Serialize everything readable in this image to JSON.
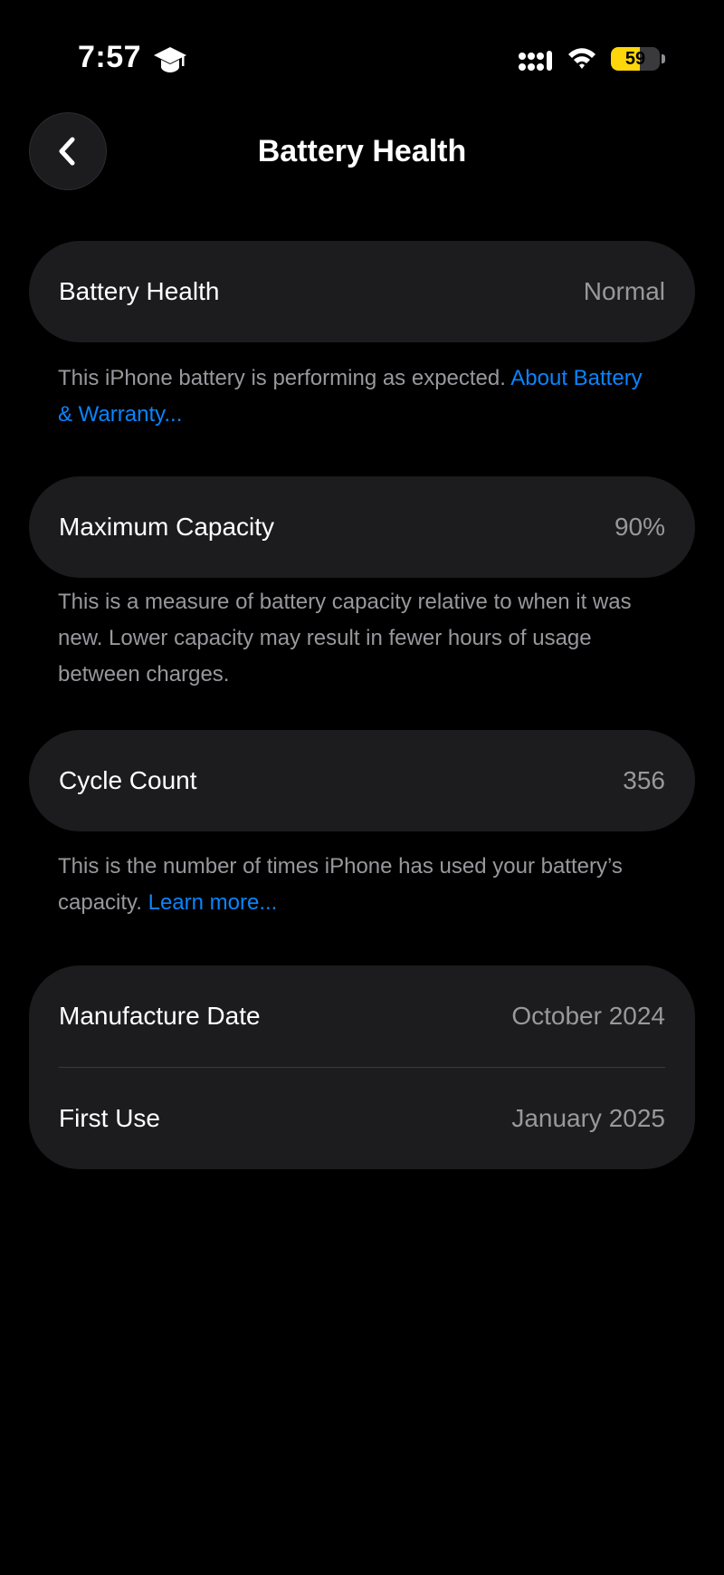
{
  "status_bar": {
    "time": "7:57",
    "battery_level": "59",
    "battery_fraction": 0.59,
    "accent_battery": "#ffd60a",
    "icons": [
      "graduation-cap-icon",
      "cellular-signal-icon",
      "wifi-icon",
      "battery-icon"
    ]
  },
  "nav": {
    "back_icon": "chevron-left-icon",
    "title": "Battery Health"
  },
  "battery_health": {
    "label": "Battery Health",
    "value": "Normal",
    "note": "This iPhone battery is performing as expected.",
    "note_link": "About Battery & Warranty..."
  },
  "maximum_capacity": {
    "label": "Maximum Capacity",
    "value": "90%",
    "note": "This is a measure of battery capacity relative to when it was new. Lower capacity may result in fewer hours of usage between charges."
  },
  "cycle_count": {
    "label": "Cycle Count",
    "value": "356",
    "note": "This is the number of times iPhone has used your battery’s capacity.",
    "note_link": "Learn more..."
  },
  "dates": {
    "manufacture_label": "Manufacture Date",
    "manufacture_value": "October 2024",
    "first_use_label": "First Use",
    "first_use_value": "January 2025"
  },
  "colors": {
    "background": "#000000",
    "card": "#1c1c1e",
    "secondary_text": "#98989d",
    "link": "#0a84ff"
  }
}
